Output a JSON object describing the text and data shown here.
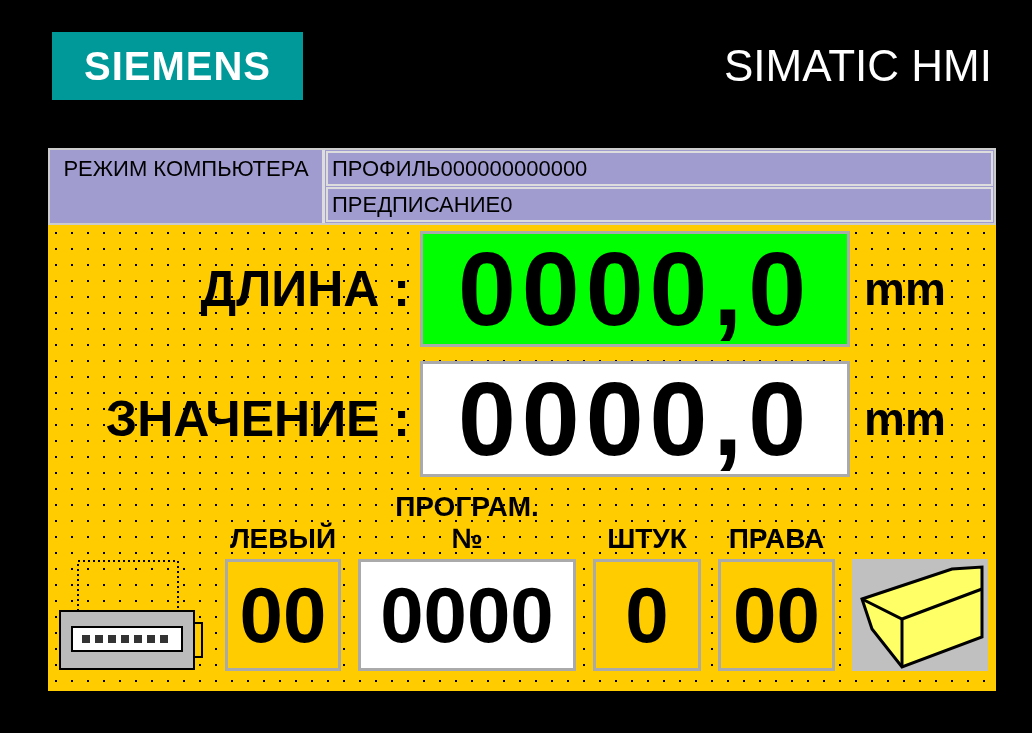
{
  "header": {
    "logo": "SIEMENS",
    "brand": "SIMATIC HMI"
  },
  "info": {
    "mode_label": "РЕЖИМ КОМПЬЮТЕРА",
    "lines": [
      "ПРОФИЛЬ000000000000",
      "ПРЕДПИСАНИЕ0"
    ]
  },
  "measurements": [
    {
      "label": "ДЛИНА :",
      "value": "0000,0",
      "unit": "mm",
      "highlighted": true
    },
    {
      "label": "ЗНАЧЕНИЕ :",
      "value": "0000,0",
      "unit": "mm",
      "highlighted": false
    }
  ],
  "counters": [
    {
      "label": "ЛЕВЫЙ",
      "value": "00",
      "kind": "display"
    },
    {
      "label": "ПРОГРАМ. №",
      "value": "0000",
      "kind": "input"
    },
    {
      "label": "ШТУК",
      "value": "0",
      "kind": "display"
    },
    {
      "label": "ПРАВА",
      "value": "00",
      "kind": "display"
    }
  ]
}
